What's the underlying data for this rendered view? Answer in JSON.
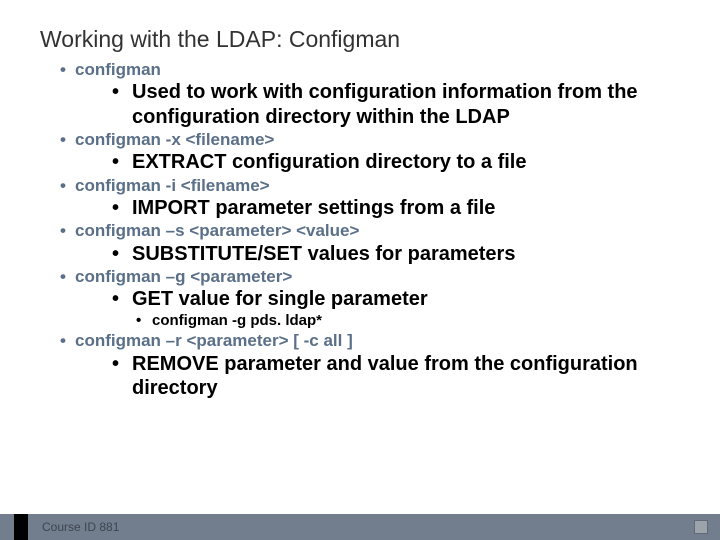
{
  "slide": {
    "title": "Working with the LDAP: Configman",
    "footer": "Course ID 881",
    "items": [
      {
        "cmd": "configman",
        "desc": "Used to work with configuration information from the configuration directory within the LDAP"
      },
      {
        "cmd": "configman -x <filename>",
        "desc": "EXTRACT configuration directory to a file"
      },
      {
        "cmd": "configman -i <filename>",
        "desc": "IMPORT parameter settings from a file"
      },
      {
        "cmd": "configman –s <parameter> <value>",
        "desc": "SUBSTITUTE/SET values for parameters"
      },
      {
        "cmd": "configman –g <parameter>",
        "desc": "GET value for single parameter",
        "example": "configman -g pds. ldap*"
      },
      {
        "cmd": "configman –r <parameter> [ -c all ]",
        "desc": "REMOVE parameter and value from the configuration directory"
      }
    ]
  }
}
